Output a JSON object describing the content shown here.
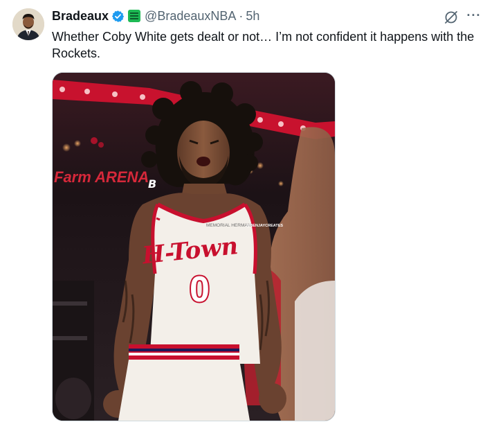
{
  "tweet": {
    "display_name": "Bradeaux",
    "handle": "@BradeauxNBA",
    "separator": "·",
    "time": "5h",
    "text": "Whether Coby White gets dealt or not… I’m not confident it happens with the Rockets.",
    "more_label": "···"
  },
  "media": {
    "arena_sign": "Farm ARENA",
    "jersey_wordmark": "H-Town",
    "jersey_number": "0",
    "jersey_patch": "MEMORIAL HERMANN",
    "watermark": "@BENJAYCREATES",
    "logo_letter": "B"
  },
  "colors": {
    "verified": "#1d9bf0",
    "affiliate_badge": "#1db954",
    "secondary_text": "#536471",
    "jersey_red": "#c8102e"
  },
  "icons": [
    "verified-badge-icon",
    "affiliate-badge-icon",
    "grok-icon",
    "more-icon"
  ]
}
